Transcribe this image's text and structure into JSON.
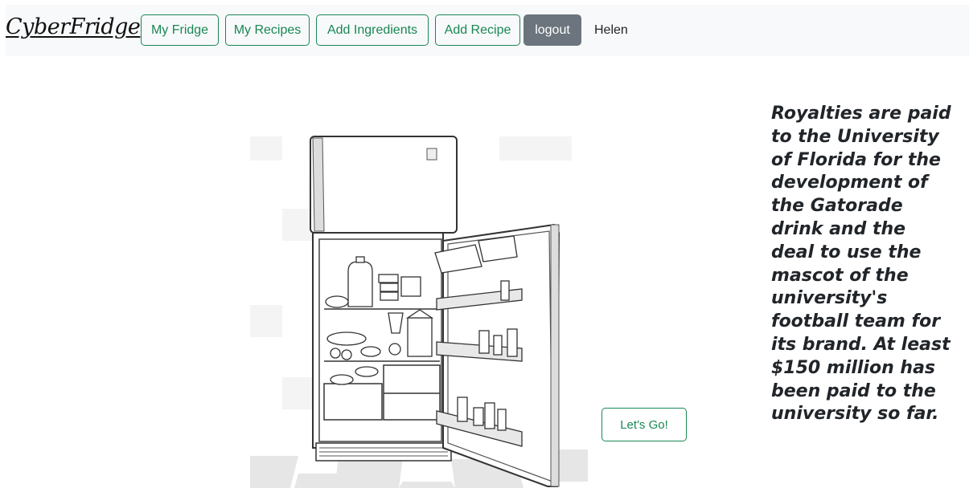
{
  "navbar": {
    "brand": "CyberFridge",
    "links": [
      "My Fridge",
      "My Recipes",
      "Add Ingredients",
      "Add Recipe"
    ],
    "logout_label": "logout",
    "username": "Helen"
  },
  "main": {
    "image_icon": "open-fridge-illustration",
    "go_label": "Let's Go!",
    "fact": "Royalties are paid to the University of Florida for the development of the Gatorade drink and the deal to use the mascot of the university's football team for its brand. At least $150 million has been paid to the university so far."
  },
  "colors": {
    "accent": "#198754",
    "navbar_bg": "#f8f9fa",
    "logout_bg": "#6c757d"
  }
}
